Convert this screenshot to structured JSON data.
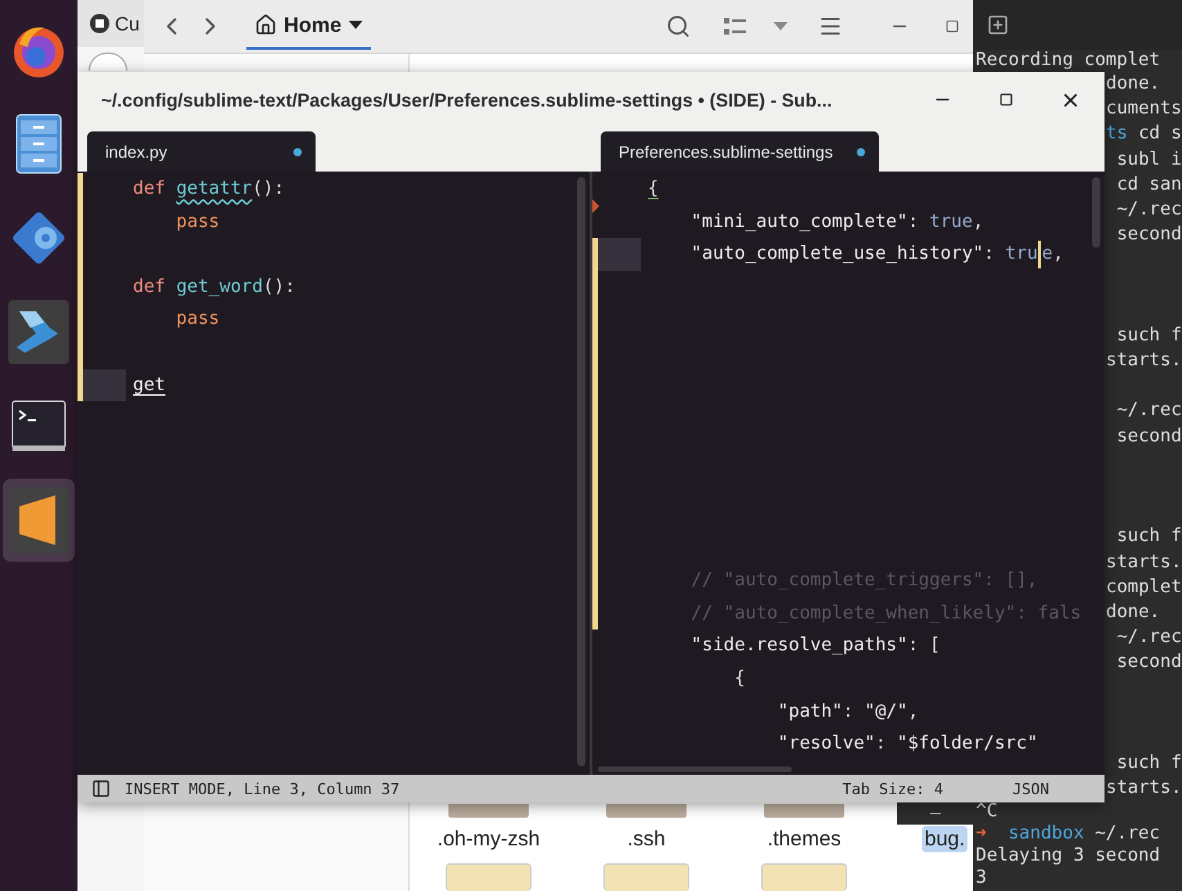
{
  "dock": {
    "items": [
      {
        "kind": "browser",
        "selected": false
      },
      {
        "kind": "files",
        "selected": false
      },
      {
        "kind": "software",
        "selected": false
      },
      {
        "kind": "remote",
        "selected": false
      },
      {
        "kind": "terminal",
        "selected": false
      },
      {
        "kind": "editor",
        "selected": true
      }
    ]
  },
  "browser_window": {
    "tab": {
      "label": "Cu"
    }
  },
  "file_manager": {
    "location": {
      "label": "Home",
      "selected": true
    },
    "items": [
      {
        "kind": "folder",
        "label": ".oh-my-zsh",
        "selected": false
      },
      {
        "kind": "folder",
        "label": ".ssh",
        "selected": false
      },
      {
        "kind": "folder",
        "label": ".themes",
        "selected": false
      },
      {
        "kind": "file",
        "label": "bug.",
        "selected": true
      },
      {
        "kind": "image",
        "selected": false
      },
      {
        "kind": "image",
        "selected": false
      },
      {
        "kind": "image",
        "selected": false
      }
    ]
  },
  "terminal": {
    "blocks": [
      {
        "lines": [
          {
            "segments": [
              {
                "text": "Recording complet",
                "kind": "plain"
              }
            ]
          },
          {
            "segments": [
              {
                "text": "done.",
                "kind": "plain"
              }
            ]
          },
          {
            "segments": [
              {
                "text": "cuments",
                "kind": "plain"
              }
            ]
          },
          {
            "segments": [
              {
                "text": "ts",
                "kind": "dir"
              },
              {
                "text": " cd s",
                "kind": "plain"
              }
            ]
          },
          {
            "segments": [
              {
                "text": " subl i",
                "kind": "plain"
              }
            ]
          },
          {
            "segments": [
              {
                "text": " cd san",
                "kind": "plain"
              }
            ]
          },
          {
            "segments": [
              {
                "text": " ~/.rec",
                "kind": "plain"
              }
            ]
          },
          {
            "segments": [
              {
                "text": " second",
                "kind": "plain"
              }
            ]
          }
        ]
      },
      {
        "lines": [
          {
            "segments": [
              {
                "text": " such f",
                "kind": "plain"
              }
            ]
          },
          {
            "segments": [
              {
                "text": "starts.",
                "kind": "plain"
              }
            ]
          }
        ]
      },
      {
        "lines": [
          {
            "segments": [
              {
                "text": " ~/.rec",
                "kind": "plain"
              }
            ]
          },
          {
            "segments": [
              {
                "text": " second",
                "kind": "plain"
              }
            ]
          }
        ]
      },
      {
        "lines": [
          {
            "segments": [
              {
                "text": " such f",
                "kind": "plain"
              }
            ]
          },
          {
            "segments": [
              {
                "text": "starts.",
                "kind": "plain"
              }
            ]
          },
          {
            "segments": [
              {
                "text": "complet",
                "kind": "plain"
              }
            ]
          },
          {
            "segments": [
              {
                "text": "done.",
                "kind": "plain"
              }
            ]
          },
          {
            "segments": [
              {
                "text": " ~/.rec",
                "kind": "plain"
              }
            ]
          },
          {
            "segments": [
              {
                "text": " second",
                "kind": "plain"
              }
            ]
          }
        ]
      },
      {
        "lines": [
          {
            "segments": [
              {
                "text": " such f",
                "kind": "plain"
              }
            ]
          },
          {
            "segments": [
              {
                "text": "starts.",
                "kind": "plain"
              }
            ]
          },
          {
            "segments": [
              {
                "text": "^C",
                "kind": "plain"
              }
            ]
          },
          {
            "segments": [
              {
                "text": "➜",
                "kind": "arrow"
              },
              {
                "text": "  sandbox",
                "kind": "dir"
              },
              {
                "text": " ~/.rec",
                "kind": "plain"
              }
            ]
          },
          {
            "segments": [
              {
                "text": "Delaying 3 second",
                "kind": "plain"
              }
            ]
          },
          {
            "segments": [
              {
                "text": "3",
                "kind": "plain"
              }
            ]
          }
        ]
      }
    ]
  },
  "editor": {
    "title": "~/.config/sublime-text/Packages/User/Preferences.sublime-settings • (SIDE) - Sub...",
    "panes": [
      {
        "tab": {
          "label": "index.py",
          "selected": true,
          "dirty": true
        },
        "scroll": {
          "level": 1
        },
        "lines": [
          {
            "modified": true,
            "current": false,
            "tokens": [
              {
                "text": "def ",
                "kind": "keyword"
              },
              {
                "text": "getattr",
                "kind": "function",
                "misspelled": true
              },
              {
                "text": "():",
                "kind": "punct"
              }
            ]
          },
          {
            "modified": true,
            "current": false,
            "tokens": [
              {
                "text": "    pass",
                "kind": "builtin"
              }
            ]
          },
          {
            "modified": true,
            "current": false
          },
          {
            "modified": true,
            "current": false,
            "tokens": [
              {
                "text": "def ",
                "kind": "keyword"
              },
              {
                "text": "get_word",
                "kind": "function"
              },
              {
                "text": "():",
                "kind": "punct"
              }
            ]
          },
          {
            "modified": true,
            "current": false,
            "tokens": [
              {
                "text": "    pass",
                "kind": "builtin"
              }
            ]
          },
          {
            "modified": true,
            "current": false
          },
          {
            "modified": true,
            "current": true,
            "tokens": [
              {
                "text": "get",
                "kind": "plain",
                "underlined": true
              }
            ]
          }
        ]
      },
      {
        "tab": {
          "label": "Preferences.sublime-settings",
          "selected": true,
          "dirty": true
        },
        "scroll": {
          "level": 0.12
        },
        "lines": [
          {
            "modified": false,
            "current": false,
            "removed_after": true,
            "tokens": [
              {
                "text": "{",
                "kind": "punct",
                "underlined": true
              }
            ]
          },
          {
            "modified": false,
            "current": false,
            "tokens": [
              {
                "text": "    \"mini_auto_complete\"",
                "kind": "string"
              },
              {
                "text": ": ",
                "kind": "punct"
              },
              {
                "text": "true",
                "kind": "bool"
              },
              {
                "text": ",",
                "kind": "punct"
              }
            ]
          },
          {
            "modified": true,
            "current": true,
            "tokens": [
              {
                "text": "    \"auto_complete_use_history\"",
                "kind": "string"
              },
              {
                "text": ": ",
                "kind": "punct"
              },
              {
                "text": "tru",
                "kind": "bool"
              },
              {
                "text": "e",
                "kind": "bool",
                "caret": true
              },
              {
                "text": ",",
                "kind": "punct"
              }
            ]
          },
          {
            "modified": true,
            "current": false
          },
          {
            "modified": true,
            "current": false
          },
          {
            "modified": true,
            "current": false
          },
          {
            "modified": true,
            "current": false
          },
          {
            "modified": true,
            "current": false
          },
          {
            "modified": true,
            "current": false
          },
          {
            "modified": true,
            "current": false
          },
          {
            "modified": true,
            "current": false
          },
          {
            "modified": true,
            "current": false
          },
          {
            "modified": true,
            "current": false,
            "tokens": [
              {
                "text": "    // \"auto_complete_triggers\": [],",
                "kind": "comment"
              }
            ]
          },
          {
            "modified": true,
            "current": false,
            "tokens": [
              {
                "text": "    // \"auto_complete_when_likely\": fals",
                "kind": "comment"
              }
            ]
          },
          {
            "modified": false,
            "current": false,
            "tokens": [
              {
                "text": "    \"side.resolve_paths\"",
                "kind": "string"
              },
              {
                "text": ": [",
                "kind": "punct"
              }
            ]
          },
          {
            "modified": false,
            "current": false,
            "tokens": [
              {
                "text": "        {",
                "kind": "punct"
              }
            ]
          },
          {
            "modified": false,
            "current": false,
            "tokens": [
              {
                "text": "            \"path\"",
                "kind": "string"
              },
              {
                "text": ": ",
                "kind": "punct"
              },
              {
                "text": "\"@/\"",
                "kind": "string"
              },
              {
                "text": ",",
                "kind": "punct"
              }
            ]
          },
          {
            "modified": false,
            "current": false,
            "tokens": [
              {
                "text": "            \"resolve\"",
                "kind": "string"
              },
              {
                "text": ": ",
                "kind": "punct"
              },
              {
                "text": "\"$folder/src\"",
                "kind": "string"
              }
            ]
          }
        ]
      }
    ],
    "status": {
      "mode": "INSERT MODE, Line 3, Column 37",
      "tab_size": "Tab Size: 4",
      "syntax": "JSON"
    }
  }
}
